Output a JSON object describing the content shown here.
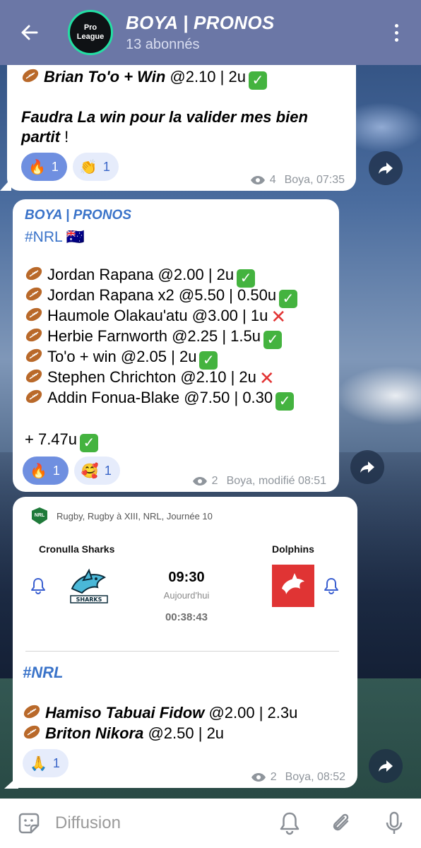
{
  "header": {
    "title": "BOYA | PRONOS",
    "subtitle": "13 abonnés",
    "avatar_text_line1": "Pro",
    "avatar_text_line2": "League"
  },
  "messages": [
    {
      "lines": [
        {
          "name": "Brian To'o + Win",
          "odds": " @2.10 | 2u",
          "status": "win"
        }
      ],
      "text_bold": "Faudra La win pour la valider mes bien partit",
      "text_tail": " !",
      "reactions": [
        {
          "emoji": "🔥",
          "count": "1",
          "active": true
        },
        {
          "emoji": "👏",
          "count": "1",
          "active": false
        }
      ],
      "views": "4",
      "meta": "Boya, 07:35"
    },
    {
      "sender": "BOYA | PRONOS",
      "hashtag": "#NRL 🇦🇺",
      "lines": [
        {
          "text": "Jordan Rapana @2.00 | 2u",
          "status": "win"
        },
        {
          "text": "Jordan Rapana x2 @5.50 | 0.50u",
          "status": "win"
        },
        {
          "text": "Haumole Olakau'atu @3.00 | 1u",
          "status": "loss"
        },
        {
          "text": "Herbie Farnworth @2.25 | 1.5u",
          "status": "win"
        },
        {
          "text": "To'o + win @2.05 | 2u",
          "status": "win"
        },
        {
          "text": "Stephen Chrichton @2.10 | 2u",
          "status": "loss"
        },
        {
          "text": "Addin Fonua-Blake @7.50 | 0.30",
          "status": "win"
        }
      ],
      "total": "+ 7.47u",
      "reactions": [
        {
          "emoji": "🔥",
          "count": "1",
          "active": true
        },
        {
          "emoji": "🥰",
          "count": "1",
          "active": false
        }
      ],
      "views": "2",
      "meta": "Boya, modifié 08:51"
    },
    {
      "match": {
        "competition": "Rugby, Rugby à XIII, NRL, Journée 10",
        "home": "Cronulla Sharks",
        "away": "Dolphins",
        "time": "09:30",
        "day": "Aujourd'hui",
        "countdown": "00:38:43",
        "league_logo_text": "NRL",
        "home_logo_text": "SHARKS"
      },
      "hashtag": "#NRL",
      "lines": [
        {
          "name": "Hamiso Tabuai Fidow",
          "odds": " @2.00 | 2.3u"
        },
        {
          "name": "Briton Nikora",
          "odds": " @2.50 | 2u"
        }
      ],
      "reactions": [
        {
          "emoji": "🙏",
          "count": "1",
          "active": false
        }
      ],
      "views": "2",
      "meta": "Boya, 08:52"
    }
  ],
  "bottom_bar": {
    "placeholder": "Diffusion"
  },
  "icons": {
    "ball": "rugby-ball-icon",
    "check": "✓",
    "cross": "✕"
  },
  "colors": {
    "header": "#6b77a6",
    "accent": "#3a73c9",
    "reaction_active": "#6f8fe0",
    "win": "#44b33f",
    "loss": "#e23434"
  }
}
